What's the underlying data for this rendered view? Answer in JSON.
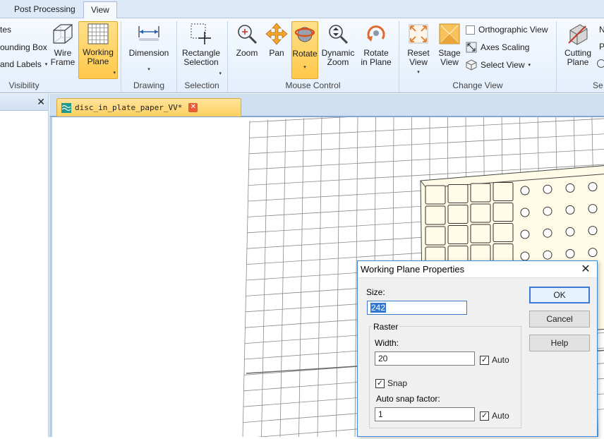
{
  "tabs": [
    {
      "label": "Post Processing",
      "active": false
    },
    {
      "label": "View",
      "active": true
    }
  ],
  "ribbon": {
    "visibility": {
      "partial_items": [
        "tes",
        "ounding Box",
        "and Labels"
      ],
      "label": "Visibility"
    },
    "wire_frame": "Wire\nFrame",
    "working_plane": "Working\nPlane",
    "drawing": {
      "dimension": "Dimension",
      "label": "Drawing"
    },
    "selection": {
      "rectangle": "Rectangle\nSelection",
      "label": "Selection"
    },
    "mouse_control": {
      "zoom": "Zoom",
      "pan": "Pan",
      "rotate": "Rotate",
      "dynamic_zoom": "Dynamic\nZoom",
      "rotate_in_plane": "Rotate\nin Plane",
      "label": "Mouse Control"
    },
    "change_view": {
      "reset_view": "Reset\nView",
      "stage_view": "Stage\nView",
      "orthographic": "Orthographic View",
      "axes_scaling": "Axes Scaling",
      "select_view": "Select View",
      "label": "Change View"
    },
    "cutting_plane": "Cutting\nPlane",
    "partial_right": {
      "n": "N",
      "p": "P",
      "se": "Se"
    }
  },
  "document": {
    "tab_title": "disc_in_plate_paper_VV*"
  },
  "dialog": {
    "title": "Working Plane Properties",
    "size_label": "Size:",
    "size_value": "242",
    "raster_label": "Raster",
    "width_label": "Width:",
    "width_value": "20",
    "width_auto": "Auto",
    "snap_label": "Snap",
    "snap_factor_label": "Auto snap factor:",
    "snap_factor_value": "1",
    "snap_auto": "Auto",
    "ok": "OK",
    "cancel": "Cancel",
    "help": "Help"
  },
  "colors": {
    "accent": "#3c78d8",
    "selected": "#ffc94a",
    "plate": "#fffbe6"
  }
}
